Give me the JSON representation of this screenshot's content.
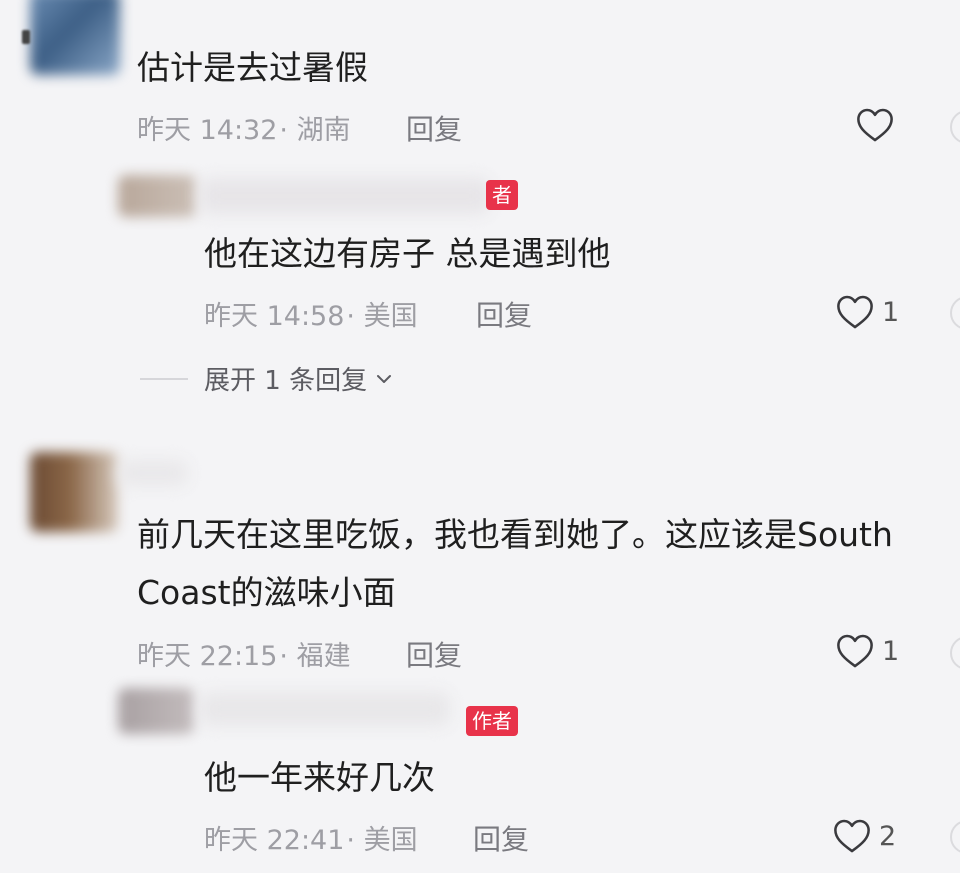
{
  "comments": [
    {
      "text": "估计是去过暑假",
      "time": "昨天 14:32",
      "location": "· 湖南",
      "reply_label": "回复",
      "likes": "",
      "replies": [
        {
          "badge": "作者",
          "badge_visible": "者",
          "text": "他在这边有房子 总是遇到他",
          "time": "昨天 14:58",
          "location": "· 美国",
          "reply_label": "回复",
          "likes": "1"
        }
      ],
      "expand_label": "展开 1 条回复"
    },
    {
      "text_line1": "前几天在这里吃饭，我也看到她了。这应该是South",
      "text_line2": "Coast的滋味小面",
      "time": "昨天 22:15",
      "location": "· 福建",
      "reply_label": "回复",
      "likes": "1",
      "replies": [
        {
          "badge": "作者",
          "text": "他一年来好几次",
          "time": "昨天 22:41",
          "location": "· 美国",
          "reply_label": "回复",
          "likes": "2"
        }
      ]
    }
  ],
  "colors": {
    "background": "#f4f4f6",
    "author_badge": "#e8334a",
    "meta_text": "#9e9ea4"
  },
  "icons": {
    "like": "heart-outline-icon",
    "expand": "chevron-down-icon"
  }
}
